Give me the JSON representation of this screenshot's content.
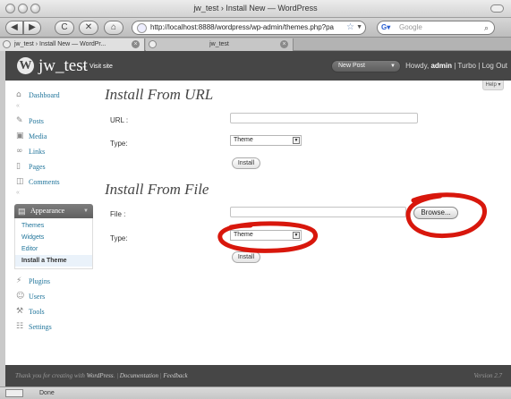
{
  "browser": {
    "window_title": "jw_test › Install New — WordPress",
    "back": "◀",
    "forward": "▶",
    "reload": "C",
    "stop": "✕",
    "home": "⌂",
    "url": "http://localhost:8888/wordpress/wp-admin/themes.php?pa",
    "search_placeholder": "Google",
    "tabs": [
      {
        "label": "jw_test › Install New — WordPr..."
      },
      {
        "label": "jw_test"
      }
    ],
    "status": "Done"
  },
  "header": {
    "site_name": "jw_test",
    "visit_site": "← Visit site",
    "new_post": "New Post",
    "howdy_prefix": "Howdy, ",
    "user": "admin",
    "sep1": " | ",
    "turbo": "Turbo",
    "sep2": " | ",
    "logout": "Log Out",
    "help": "Help ▾"
  },
  "menu": {
    "dashboard": "Dashboard",
    "posts": "Posts",
    "media": "Media",
    "links": "Links",
    "pages": "Pages",
    "comments": "Comments",
    "appearance": "Appearance",
    "appearance_sub": [
      "Themes",
      "Widgets",
      "Editor",
      "Install a Theme"
    ],
    "plugins": "Plugins",
    "users": "Users",
    "tools": "Tools",
    "settings": "Settings"
  },
  "install_url": {
    "heading": "Install From URL",
    "url_label": "URL :",
    "url_value": "",
    "type_label": "Type:",
    "type_value": "Theme",
    "install": "Install"
  },
  "install_file": {
    "heading": "Install From File",
    "file_label": "File :",
    "file_value": "",
    "browse": "Browse...",
    "type_label": "Type:",
    "type_value": "Theme",
    "install": "Install"
  },
  "footer": {
    "thanks_prefix": "Thank you for creating with ",
    "wordpress": "WordPress",
    "sep1": ". | ",
    "documentation": "Documentation",
    "sep2": " | ",
    "feedback": "Feedback",
    "version": "Version 2.7"
  },
  "colors": {
    "annotation": "#d8170c",
    "link": "#21759b",
    "header_bg": "#464646"
  },
  "icons": {
    "dashboard": "house-icon",
    "posts": "pin-icon",
    "media": "media-icon",
    "links": "link-icon",
    "pages": "page-icon",
    "comments": "comment-icon",
    "appearance": "appearance-icon",
    "plugins": "plug-icon",
    "users": "users-icon",
    "tools": "tools-icon",
    "settings": "settings-icon"
  }
}
